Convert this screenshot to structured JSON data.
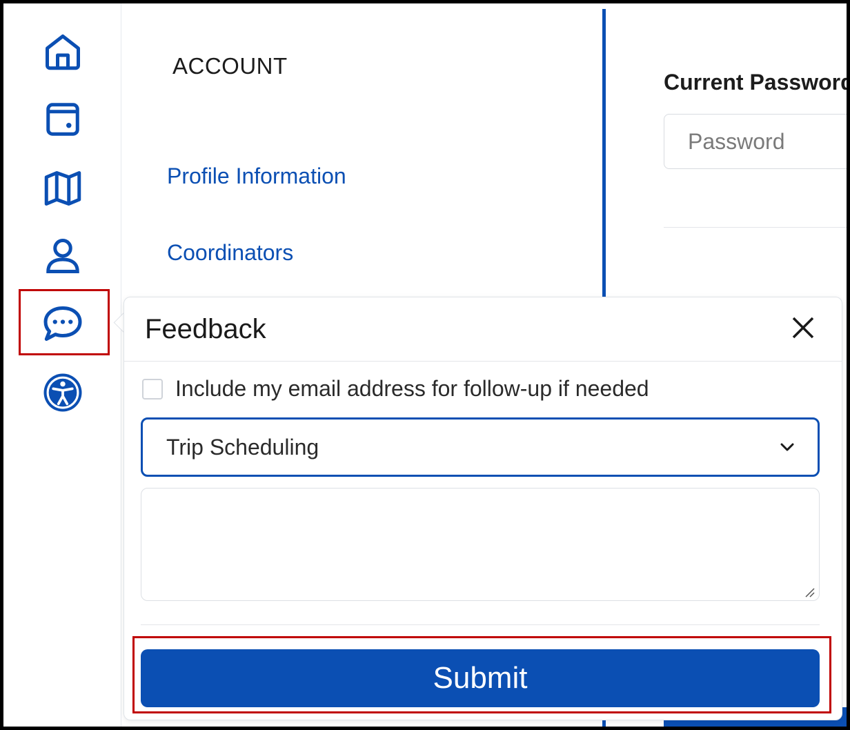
{
  "sidebar": {
    "icons": [
      {
        "name": "home-icon"
      },
      {
        "name": "calendar-icon"
      },
      {
        "name": "map-icon"
      },
      {
        "name": "profile-icon"
      },
      {
        "name": "feedback-icon"
      },
      {
        "name": "accessibility-icon"
      }
    ]
  },
  "account_nav": {
    "title": "ACCOUNT",
    "links": [
      "Profile Information",
      "Coordinators"
    ]
  },
  "password_form": {
    "current_password_label": "Current Password",
    "password_placeholder": "Password"
  },
  "feedback": {
    "title": "Feedback",
    "include_email_label": "Include my email address for follow-up if needed",
    "include_email_checked": false,
    "category_selected": "Trip Scheduling",
    "message_value": "",
    "submit_label": "Submit"
  },
  "colors": {
    "brand_blue": "#0b4fb3",
    "highlight_red": "#c00000"
  }
}
